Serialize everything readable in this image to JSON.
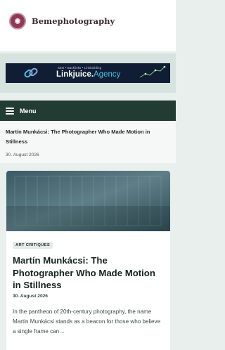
{
  "site": {
    "name": "Bemephotography"
  },
  "ad": {
    "tagline": "SEO  •  Backlinks  •  Linkbuilding",
    "brand_main": "Linkjuice.",
    "brand_accent": "Agency",
    "colors": {
      "background": "#101d34",
      "accent": "#45c2e8"
    }
  },
  "nav": {
    "menu_label": "Menu",
    "icon": "hamburger-icon"
  },
  "post": {
    "title": "Martín Munkácsi: The Photographer Who Made Motion in Stillness",
    "date": "30. August 2026"
  },
  "card": {
    "category": "ART CRITIQUES",
    "title": "Martín Munkácsi: The Photographer Who Made Motion in Stillness",
    "date": "30. August 2026",
    "excerpt": "In the pantheon of 20th-century photography, the name Martin Munkácsi stands as a beacon for those who believe a single frame can…"
  },
  "colors": {
    "menu_bar": "#223b33",
    "page_background": "#e9efed",
    "logo": "#8c3a55"
  }
}
